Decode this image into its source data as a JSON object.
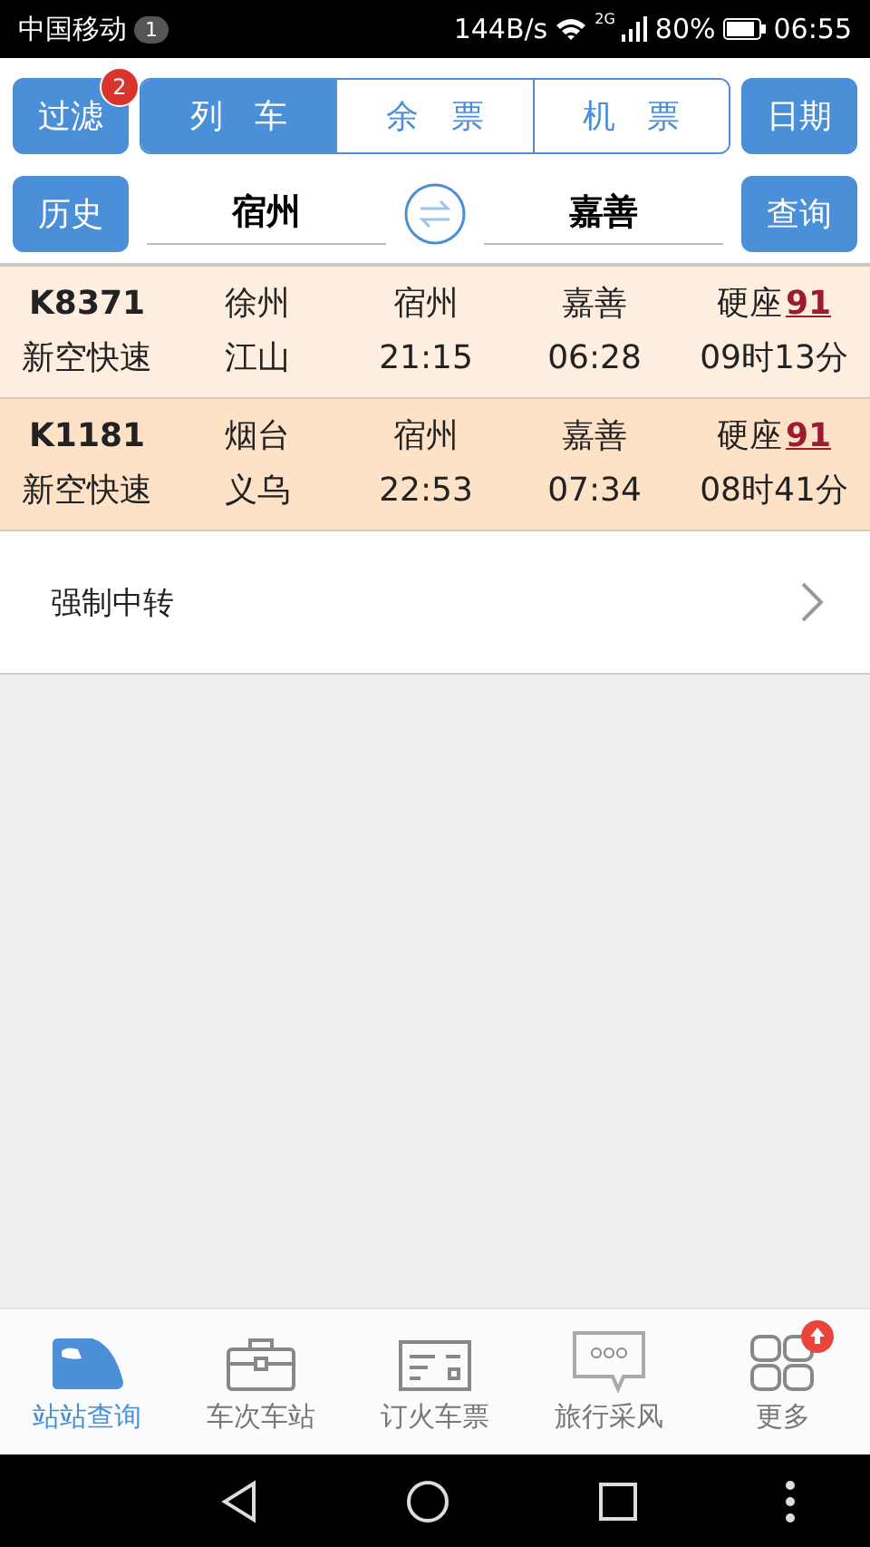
{
  "status_bar": {
    "carrier": "中国移动",
    "notification_count": "1",
    "speed": "144B/s",
    "network": "2G",
    "battery": "80%",
    "time": "06:55"
  },
  "top_bar": {
    "filter_button": "过滤",
    "filter_badge": "2",
    "date_button": "日期",
    "tabs": [
      {
        "label": "列 车",
        "selected": true
      },
      {
        "label": "余 票",
        "selected": false
      },
      {
        "label": "机 票",
        "selected": false
      }
    ]
  },
  "search_bar": {
    "history_button": "历史",
    "from": "宿州",
    "to": "嘉善",
    "query_button": "查询"
  },
  "trains": [
    {
      "number": "K8371",
      "type": "新空快速",
      "origin": "徐州",
      "terminus": "江山",
      "from": "宿州",
      "depart": "21:15",
      "to": "嘉善",
      "arrive": "06:28",
      "seat": "硬座",
      "seat_count": "91",
      "duration": "09时13分"
    },
    {
      "number": "K1181",
      "type": "新空快速",
      "origin": "烟台",
      "terminus": "义乌",
      "from": "宿州",
      "depart": "22:53",
      "to": "嘉善",
      "arrive": "07:34",
      "seat": "硬座",
      "seat_count": "91",
      "duration": "08时41分"
    }
  ],
  "transfer_item": "强制中转",
  "bottom_nav": [
    {
      "label": "站站查询",
      "kind": "train",
      "selected": true,
      "badge": false
    },
    {
      "label": "车次车站",
      "kind": "briefcase",
      "selected": false,
      "badge": false
    },
    {
      "label": "订火车票",
      "kind": "ticket",
      "selected": false,
      "badge": false
    },
    {
      "label": "旅行采风",
      "kind": "chat",
      "selected": false,
      "badge": false
    },
    {
      "label": "更多",
      "kind": "grid",
      "selected": false,
      "badge": true
    }
  ]
}
